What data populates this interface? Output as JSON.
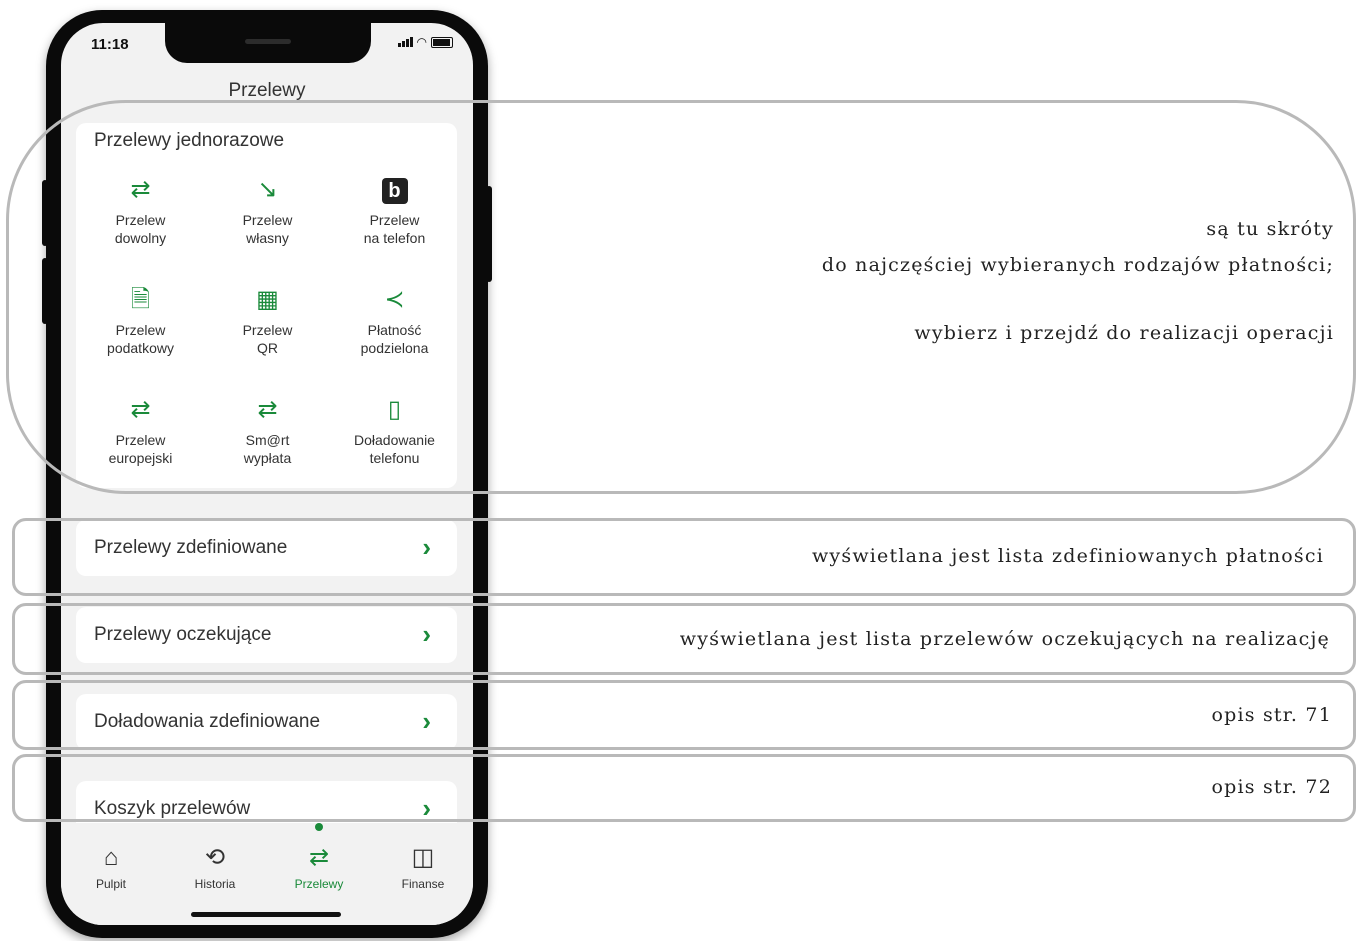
{
  "status": {
    "time": "11:18"
  },
  "screen_title": "Przelewy",
  "one_time": {
    "title": "Przelewy jednorazowe",
    "tiles": [
      {
        "label": "Przelew\ndowolny",
        "icon": "transfer-cycle-icon"
      },
      {
        "label": "Przelew\nwłasny",
        "icon": "arrow-down-right-icon"
      },
      {
        "label": "Przelew\nna telefon",
        "icon": "blik-icon"
      },
      {
        "label": "Przelew\npodatkowy",
        "icon": "tax-document-icon"
      },
      {
        "label": "Przelew\nQR",
        "icon": "qr-code-icon"
      },
      {
        "label": "Płatność\npodzielona",
        "icon": "split-payment-icon"
      },
      {
        "label": "Przelew\neuropejski",
        "icon": "transfer-cycle-icon"
      },
      {
        "label": "Sm@rt\nwypłata",
        "icon": "transfer-cycle-icon"
      },
      {
        "label": "Doładowanie\ntelefonu",
        "icon": "phone-topup-icon"
      }
    ]
  },
  "rows": [
    {
      "label": "Przelewy zdefiniowane"
    },
    {
      "label": "Przelewy oczekujące"
    },
    {
      "label": "Doładowania zdefiniowane"
    },
    {
      "label": "Koszyk przelewów"
    }
  ],
  "tabs": [
    {
      "label": "Pulpit",
      "icon": "home-icon"
    },
    {
      "label": "Historia",
      "icon": "history-icon"
    },
    {
      "label": "Przelewy",
      "icon": "transfer-cycle-icon",
      "active": true
    },
    {
      "label": "Finanse",
      "icon": "wallet-icon"
    }
  ],
  "annotations": {
    "one_time_line1": "są tu skróty",
    "one_time_line2": "do najczęściej wybieranych rodzajów płatności;",
    "one_time_line3": "wybierz i przejdź do realizacji operacji",
    "defined": "wyświetlana jest lista zdefiniowanych płatności",
    "pending": "wyświetlana jest lista przelewów oczekujących na realizację",
    "topups": "opis str. 71",
    "basket": "opis str. 72"
  },
  "colors": {
    "accent": "#1a8a3a",
    "outline": "#b9b9b9",
    "phone": "#0a0a0a"
  }
}
